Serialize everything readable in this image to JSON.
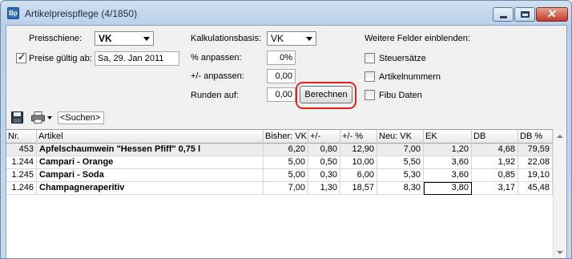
{
  "window": {
    "app_icon": "Bp",
    "title": "Artikelpreispflege (4/1850)"
  },
  "form": {
    "preisschiene_label": "Preisschiene:",
    "preisschiene_value": "VK",
    "preise_gueltig_label": "Preise gültig ab:",
    "preise_gueltig_checked": true,
    "preise_gueltig_value": "Sa, 29. Jan 2011",
    "kalkulationsbasis_label": "Kalkulationsbasis:",
    "kalkulationsbasis_value": "VK",
    "prozent_label": "% anpassen:",
    "prozent_value": "0%",
    "plusminus_label": "+/- anpassen:",
    "plusminus_value": "0,00",
    "runden_label": "Runden auf:",
    "runden_value": "0,00",
    "berechnen_label": "Berechnen",
    "weitere_felder_label": "Weitere Felder einblenden:",
    "steuersaetze_label": "Steuersätze",
    "steuersaetze_checked": false,
    "artikelnummern_label": "Artikelnummern",
    "artikelnummern_checked": false,
    "fibu_label": "Fibu Daten",
    "fibu_checked": false
  },
  "toolbar": {
    "save_icon": "floppy-disk-icon",
    "print_icon": "printer-icon",
    "search_placeholder": "<Suchen>"
  },
  "table": {
    "columns": [
      "Nr.",
      "Artikel",
      "Bisher: VK",
      "+/-",
      "+/- %",
      "Neu: VK",
      "EK",
      "DB",
      "DB %"
    ],
    "rows": [
      [
        "453",
        "Apfelschaumwein \"Hessen Pfiff\" 0,75 l",
        "6,20",
        "0,80",
        "12,90",
        "7,00",
        "1,20",
        "4,68",
        "79,59"
      ],
      [
        "1.244",
        "Campari - Orange",
        "5,00",
        "0,50",
        "10,00",
        "5,50",
        "3,60",
        "1,92",
        "22,08"
      ],
      [
        "1.245",
        "Campari - Soda",
        "5,00",
        "0,30",
        "6,00",
        "5,30",
        "3,60",
        "0,85",
        "19,10"
      ],
      [
        "1.246",
        "Champagneraperitiv",
        "7,00",
        "1,30",
        "18,57",
        "8,30",
        "3,80",
        "3,17",
        "45,48"
      ]
    ]
  },
  "colors": {
    "highlight": "#e0221a",
    "titlebar": "#b9d1ea",
    "close_button": "#c0392b"
  }
}
